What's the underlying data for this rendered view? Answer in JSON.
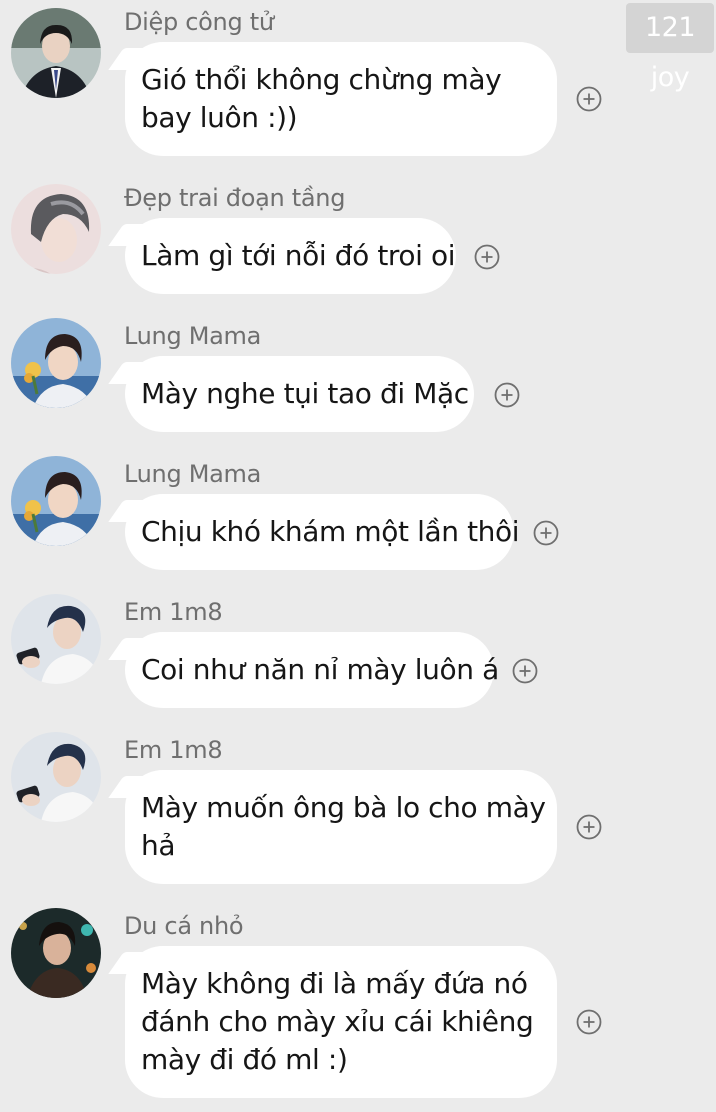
{
  "watermark": "121 joy",
  "messages": [
    {
      "sender": "Diệp công tử",
      "avatar": "avatar-boy-suit",
      "lines": [
        "Gió thổi không chừng mày",
        "bay luôn :))"
      ]
    },
    {
      "sender": "Đẹp trai đoạn tầng",
      "avatar": "avatar-boy-gray-hair",
      "lines": [
        "Làm gì tới nỗi đó troi oi"
      ]
    },
    {
      "sender": "Lung Mama",
      "avatar": "avatar-boy-flower",
      "lines": [
        "Mày nghe tụi tao đi Mặc"
      ]
    },
    {
      "sender": "Lung Mama",
      "avatar": "avatar-boy-flower",
      "lines": [
        "Chịu khó khám một lần thôi"
      ]
    },
    {
      "sender": "Em 1m8",
      "avatar": "avatar-boy-phone",
      "lines": [
        "Coi như năn nỉ mày luôn á"
      ]
    },
    {
      "sender": "Em 1m8",
      "avatar": "avatar-boy-phone",
      "lines": [
        "Mày muốn ông bà lo cho mày",
        "hả"
      ]
    },
    {
      "sender": "Du cá nhỏ",
      "avatar": "avatar-boy-night",
      "lines": [
        "Mày không đi là mấy đứa nó",
        "đánh cho mày xỉu cái khiêng",
        "mày đi đó ml :)"
      ]
    }
  ],
  "react_icon": "plus-circle-icon"
}
